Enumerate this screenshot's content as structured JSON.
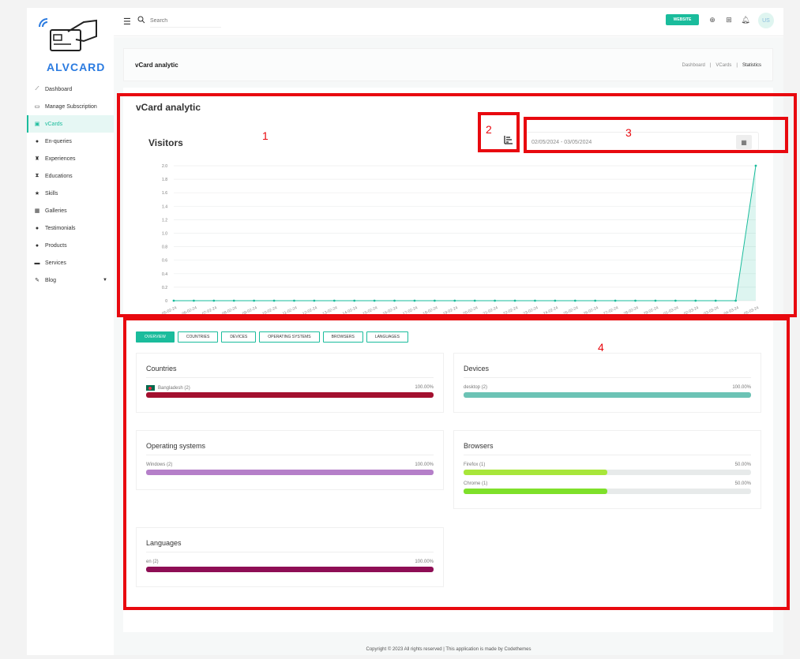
{
  "brand": {
    "name": "ALVCARD"
  },
  "sidebar": {
    "items": [
      {
        "label": "Dashboard",
        "icon": "chart-line-icon"
      },
      {
        "label": "Manage Subscription",
        "icon": "card-icon"
      },
      {
        "label": "vCards",
        "icon": "id-card-icon",
        "active": true
      },
      {
        "label": "En-queries",
        "icon": "question-icon"
      },
      {
        "label": "Experiences",
        "icon": "award-icon"
      },
      {
        "label": "Educations",
        "icon": "hourglass-icon"
      },
      {
        "label": "Skills",
        "icon": "star-icon"
      },
      {
        "label": "Galleries",
        "icon": "gallery-icon"
      },
      {
        "label": "Testimonials",
        "icon": "quote-icon"
      },
      {
        "label": "Products",
        "icon": "product-icon"
      },
      {
        "label": "Services",
        "icon": "service-icon"
      },
      {
        "label": "Blog",
        "icon": "blog-icon",
        "has_caret": true
      }
    ]
  },
  "topbar": {
    "search_placeholder": "Search",
    "website_label": "WEBSITE",
    "avatar_initials": "US"
  },
  "page": {
    "title": "vCard analytic",
    "breadcrumb": [
      "Dashboard",
      "VCards",
      "Statistics"
    ]
  },
  "card": {
    "title": "vCard analytic",
    "visitors_label": "Visitors",
    "date_range": "02/05/2024 - 03/05/2024"
  },
  "chart_data": {
    "type": "area",
    "x": [
      "05-02-24",
      "06-02-24",
      "07-02-24",
      "08-02-24",
      "09-02-24",
      "10-02-24",
      "11-02-24",
      "12-02-24",
      "13-02-24",
      "14-02-24",
      "15-02-24",
      "16-02-24",
      "17-02-24",
      "18-02-24",
      "19-02-24",
      "20-02-24",
      "21-02-24",
      "22-02-24",
      "23-02-24",
      "24-02-24",
      "25-02-24",
      "26-02-24",
      "27-02-24",
      "28-02-24",
      "29-02-24",
      "01-03-24",
      "02-03-24",
      "03-03-24",
      "04-03-24",
      "05-03-24"
    ],
    "values": [
      0,
      0,
      0,
      0,
      0,
      0,
      0,
      0,
      0,
      0,
      0,
      0,
      0,
      0,
      0,
      0,
      0,
      0,
      0,
      0,
      0,
      0,
      0,
      0,
      0,
      0,
      0,
      0,
      0,
      2
    ],
    "yticks": [
      "2.0",
      "1.8",
      "1.6",
      "1.4",
      "1.2",
      "1.0",
      "0.8",
      "0.6",
      "0.4",
      "0.2",
      "0"
    ],
    "ylim": [
      0,
      2
    ],
    "color": "#1abc9c",
    "grid": true
  },
  "tabs": [
    "OVERVIEW",
    "COUNTRIES",
    "DEVICES",
    "OPERATING SYSTEMS",
    "BROWSERS",
    "LANGUAGES"
  ],
  "stats": {
    "countries": {
      "title": "Countries",
      "rows": [
        {
          "label": "Bangladesh (2)",
          "pct": "100.00%",
          "fraction": 1.0,
          "color": "#a3102f"
        }
      ]
    },
    "devices": {
      "title": "Devices",
      "rows": [
        {
          "label": "desktop (2)",
          "pct": "100.00%",
          "fraction": 1.0,
          "color": "#6cc3b5"
        }
      ]
    },
    "os": {
      "title": "Operating systems",
      "rows": [
        {
          "label": "Windows (2)",
          "pct": "100.00%",
          "fraction": 1.0,
          "color": "#b57fc9"
        }
      ]
    },
    "browsers": {
      "title": "Browsers",
      "rows": [
        {
          "label": "Firefox (1)",
          "pct": "50.00%",
          "fraction": 0.5,
          "color": "#a8e63a"
        },
        {
          "label": "Chrome (1)",
          "pct": "50.00%",
          "fraction": 0.5,
          "color": "#7ee02a"
        }
      ]
    },
    "languages": {
      "title": "Languages",
      "rows": [
        {
          "label": "en (2)",
          "pct": "100.00%",
          "fraction": 1.0,
          "color": "#8e0e55"
        }
      ]
    }
  },
  "footer": {
    "text": "Copyright © 2023 All rights reserved | This application is made by Codethemes"
  },
  "annotations": [
    "1",
    "2",
    "3",
    "4"
  ]
}
